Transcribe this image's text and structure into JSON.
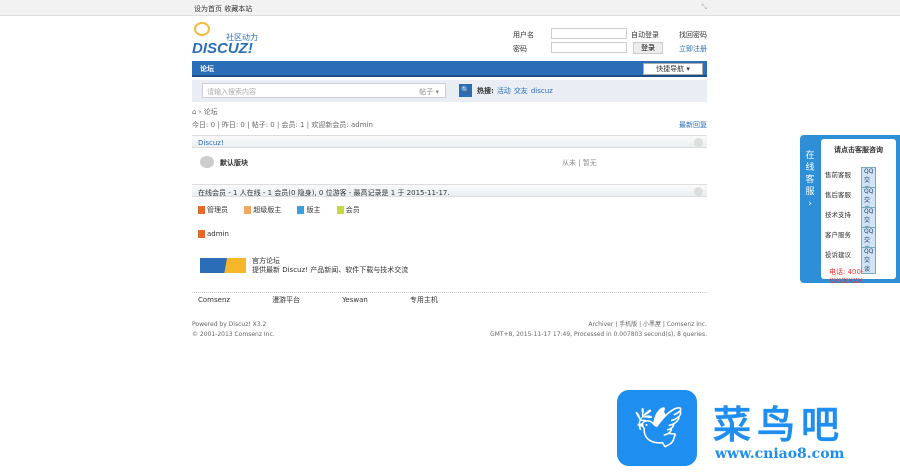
{
  "topbar": {
    "links": "设为首页 收藏本站",
    "close": "⤡"
  },
  "logo": {
    "name": "DISCUZ!",
    "slogan": "社区动力"
  },
  "login": {
    "username_label": "用户名",
    "password_label": "密码",
    "auto_login": "自动登录",
    "forgot": "找回密码",
    "login_button": "登录",
    "register": "立即注册"
  },
  "nav": {
    "forum": "论坛",
    "quick_nav": "快捷导航 ▾"
  },
  "search": {
    "placeholder": "请输入搜索内容",
    "type": "帖子 ▾",
    "button": "🔍",
    "hot_label": "热搜:",
    "hot": [
      "活动",
      "交友",
      "discuz"
    ]
  },
  "breadcrumb": "⌂ › 论坛",
  "stats": {
    "text": "今日: 0 | 昨日: 0 | 帖子: 0 | 会员: 1 | 欢迎新会员: admin",
    "latest": "最新回复"
  },
  "category": {
    "title": "Discuz!"
  },
  "forum": {
    "name": "默认版块",
    "last": "从未 | 暂无"
  },
  "online": {
    "title": "在线会员 - 1 人在线 - 1 会员(0 隐身), 0 位游客 - 最高记录是 1 于 2015-11-17."
  },
  "legend": [
    "管理员",
    "超级版主",
    "版主",
    "会员"
  ],
  "legend_colors": [
    "#e86a2a",
    "#f0a860",
    "#3aa0d8",
    "#c8d840"
  ],
  "online_user": "admin",
  "links": {
    "title": "官方论坛",
    "desc": "提供最新 Discuz! 产品新闻、软件下载与技术交流",
    "items": [
      "Comsenz",
      "漫游平台",
      "Yeswan",
      "专用主机"
    ]
  },
  "footer": {
    "powered": "Powered by Discuz! X3.2",
    "copy": "© 2001-2013 Comsenz Inc.",
    "right": "Archiver | 手机版 | 小黑屋 | Comsenz Inc.",
    "time": "GMT+8, 2015-11-17 17:49, Processed in 0.007803 second(s), 8 queries."
  },
  "service": {
    "tab": "在线客服 ›",
    "title": "请点击客服咨询",
    "rows": [
      "售前客服",
      "售后客服",
      "技术支持",
      "客户服务",
      "投诉建议"
    ],
    "qq": "QQ交谈",
    "tel": "电话: 400-XXXXXXX"
  },
  "watermark": {
    "name": "菜鸟吧",
    "url": "www.cniao8.com"
  }
}
